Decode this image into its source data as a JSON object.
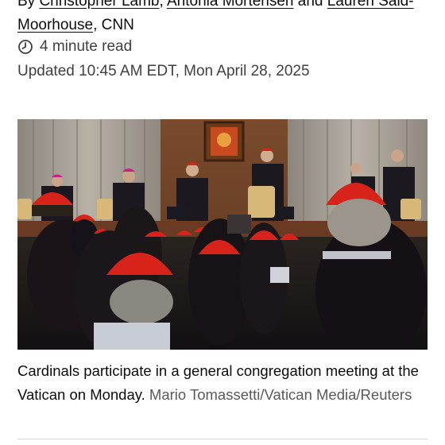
{
  "article": {
    "byline": {
      "prefix": "By ",
      "authors": [
        "Christopher Lamb",
        "Antonia Mortensen",
        "Lauren Said-Moorhouse"
      ],
      "sep1": ", ",
      "sep2": " and ",
      "suffix": ", CNN"
    },
    "read_time": "4 minute read",
    "updated": "Updated 10:45 AM EDT, Mon April 28, 2025",
    "image": {
      "icon": "photo-of-cardinals"
    },
    "caption": {
      "text": "Cardinals participate in a general congregation meeting at the Vatican on Monday.",
      "credit": "Mario Tomassetti/Vatican Media/Reuters"
    }
  },
  "colors": {
    "text": "#0c0c0c",
    "meta": "#404040",
    "credit": "#595959",
    "cardinal_red": "#d8231b"
  }
}
